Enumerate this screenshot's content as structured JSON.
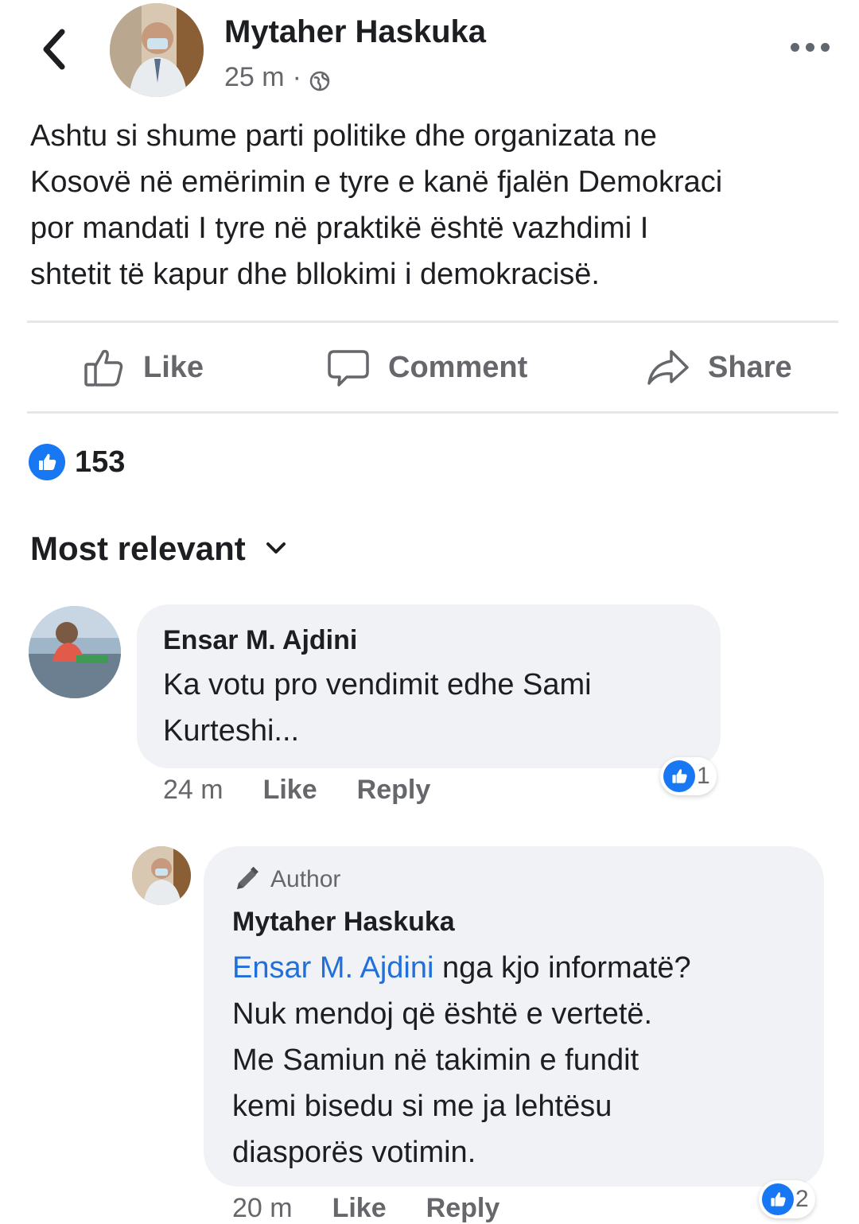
{
  "header": {
    "author_name": "Mytaher Haskuka",
    "time": "25 m",
    "separator": "·",
    "privacy_icon": "globe-icon"
  },
  "post": {
    "lines": [
      "Ashtu si shume parti politike dhe organizata ne",
      "Kosovë në emërimin e tyre e kanë fjalën Demokraci",
      "por mandati I tyre në praktikë është vazhdimi I",
      "shtetit të kapur dhe bllokimi i demokracisë."
    ]
  },
  "actions": {
    "like": "Like",
    "comment": "Comment",
    "share": "Share"
  },
  "reactions": {
    "count": "153"
  },
  "sort": {
    "label": "Most relevant"
  },
  "comments": [
    {
      "name": "Ensar M. Ajdini",
      "lines": [
        "Ka votu pro vendimit edhe Sami",
        "Kurteshi..."
      ],
      "time": "24 m",
      "like": "Like",
      "reply": "Reply",
      "reaction_count": "1"
    }
  ],
  "reply": {
    "badge": "Author",
    "name": "Mytaher Haskuka",
    "mention": "Ensar M. Ajdini",
    "first_line_rest": " nga kjo informatë?",
    "lines": [
      "Nuk mendoj që është e vertetë.",
      "Me Samiun në takimin e fundit",
      "kemi bisedu si me ja lehtësu",
      "diasporës votimin."
    ],
    "time": "20 m",
    "like": "Like",
    "reply": "Reply",
    "reaction_count": "2"
  },
  "colors": {
    "like_blue": "#1877f2",
    "mention_blue": "#216fdb",
    "bubble_gray": "#f0f2f5",
    "secondary_text": "#65676b"
  }
}
